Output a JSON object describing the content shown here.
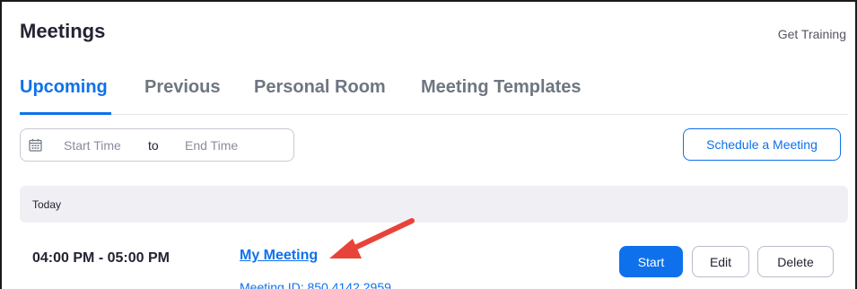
{
  "header": {
    "title": "Meetings",
    "get_training": "Get Training"
  },
  "tabs": [
    {
      "label": "Upcoming",
      "active": true
    },
    {
      "label": "Previous",
      "active": false
    },
    {
      "label": "Personal Room",
      "active": false
    },
    {
      "label": "Meeting Templates",
      "active": false
    }
  ],
  "filter": {
    "icon": "calendar-icon",
    "start_placeholder": "Start Time",
    "separator": "to",
    "end_placeholder": "End Time"
  },
  "actions": {
    "schedule_label": "Schedule a Meeting"
  },
  "day_group": {
    "label": "Today"
  },
  "meeting": {
    "time": "04:00 PM - 05:00 PM",
    "topic": "My Meeting",
    "meeting_id": "Meeting ID: 850 4142 2959",
    "start_label": "Start",
    "edit_label": "Edit",
    "delete_label": "Delete"
  },
  "colors": {
    "accent": "#0e71eb",
    "annotation_arrow": "#e8433a"
  }
}
